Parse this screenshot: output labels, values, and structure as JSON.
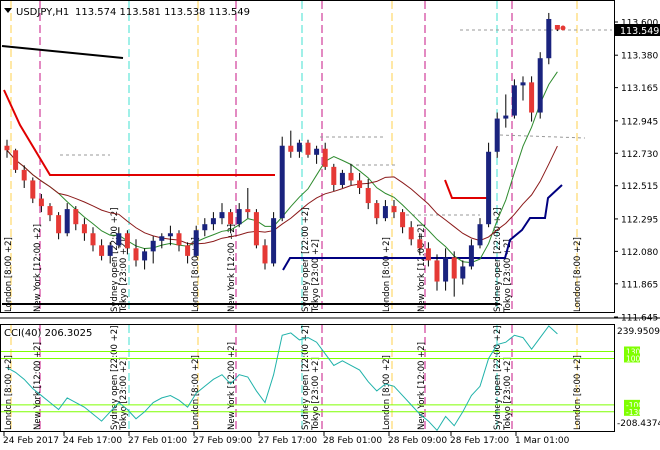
{
  "header": {
    "symbol_timeframe": "USDJPY,H1",
    "ohlc": "113.574 113.581 113.538 113.549"
  },
  "main_panel": {
    "price_labels": [
      "113.600",
      "113.380",
      "113.165",
      "112.945",
      "112.730",
      "112.515",
      "112.295",
      "112.080",
      "111.865",
      "111.645"
    ],
    "current_price": "113.549"
  },
  "indicator_panel": {
    "title": "CCI(40) 206.3025",
    "scale_labels": [
      "239.9509",
      "-208.4374"
    ],
    "level_labels": [
      "130",
      "100",
      "-100",
      "-130"
    ]
  },
  "session_labels": {
    "london": "London [8:00 +2]",
    "new_york": "New York [12:00 +2]",
    "sydney": "Sydney open [22:00 +2]",
    "tokyo": "Tokyo [23:00 +2]"
  },
  "time_labels": [
    "24 Feb 2017",
    "24 Feb 17:00",
    "27 Feb 01:00",
    "27 Feb 09:00",
    "27 Feb 17:00",
    "28 Feb 01:00",
    "28 Feb 09:00",
    "28 Feb 17:00",
    "1 Mar 01:00"
  ],
  "colors": {
    "bull_candle": "#1a237e",
    "bear_candle": "#e53935",
    "ma_green": "#2e8b2e",
    "ma_dark_red": "#8b1a1a",
    "line_red": "#e00000",
    "line_navy": "#000080",
    "cci_line": "#20b2aa",
    "level_green": "#7fff00",
    "session_london": "#ffd24d",
    "session_newyork": "#c71585",
    "session_sydney": "#40e0d0"
  },
  "chart_data": {
    "type": "candlestick",
    "ohlc": [
      [
        112.78,
        112.82,
        112.7,
        112.75
      ],
      [
        112.75,
        112.76,
        112.6,
        112.62
      ],
      [
        112.62,
        112.65,
        112.5,
        112.55
      ],
      [
        112.55,
        112.57,
        112.4,
        112.43
      ],
      [
        112.43,
        112.46,
        112.34,
        112.38
      ],
      [
        112.38,
        112.4,
        112.28,
        112.32
      ],
      [
        112.32,
        112.34,
        112.16,
        112.2
      ],
      [
        112.2,
        112.4,
        112.18,
        112.36
      ],
      [
        112.36,
        112.38,
        112.22,
        112.26
      ],
      [
        112.26,
        112.3,
        112.15,
        112.2
      ],
      [
        112.2,
        112.24,
        112.08,
        112.12
      ],
      [
        112.12,
        112.16,
        112.02,
        112.05
      ],
      [
        112.05,
        112.14,
        112.0,
        112.12
      ],
      [
        112.12,
        112.24,
        112.1,
        112.2
      ],
      [
        112.2,
        112.22,
        112.06,
        112.1
      ],
      [
        112.1,
        112.16,
        111.98,
        112.02
      ],
      [
        112.02,
        112.1,
        111.96,
        112.08
      ],
      [
        112.08,
        112.18,
        112.0,
        112.15
      ],
      [
        112.15,
        112.2,
        112.1,
        112.18
      ],
      [
        112.18,
        112.25,
        112.12,
        112.2
      ],
      [
        112.2,
        112.22,
        112.08,
        112.12
      ],
      [
        112.12,
        112.14,
        112.0,
        112.05
      ],
      [
        112.05,
        112.25,
        112.04,
        112.22
      ],
      [
        112.22,
        112.3,
        112.18,
        112.26
      ],
      [
        112.26,
        112.34,
        112.22,
        112.3
      ],
      [
        112.3,
        112.4,
        112.26,
        112.34
      ],
      [
        112.34,
        112.36,
        112.2,
        112.26
      ],
      [
        112.26,
        112.4,
        112.24,
        112.36
      ],
      [
        112.36,
        112.5,
        112.3,
        112.34
      ],
      [
        112.34,
        112.36,
        112.1,
        112.12
      ],
      [
        112.12,
        112.16,
        111.96,
        112.0
      ],
      [
        112.0,
        112.34,
        111.98,
        112.3
      ],
      [
        112.3,
        112.84,
        112.28,
        112.78
      ],
      [
        112.78,
        112.88,
        112.7,
        112.74
      ],
      [
        112.74,
        112.82,
        112.7,
        112.8
      ],
      [
        112.8,
        112.82,
        112.7,
        112.72
      ],
      [
        112.72,
        112.78,
        112.66,
        112.76
      ],
      [
        112.76,
        112.8,
        112.62,
        112.64
      ],
      [
        112.64,
        112.66,
        112.48,
        112.52
      ],
      [
        112.52,
        112.62,
        112.5,
        112.6
      ],
      [
        112.6,
        112.66,
        112.52,
        112.55
      ],
      [
        112.55,
        112.6,
        112.46,
        112.5
      ],
      [
        112.5,
        112.56,
        112.36,
        112.4
      ],
      [
        112.4,
        112.42,
        112.26,
        112.3
      ],
      [
        112.3,
        112.42,
        112.28,
        112.38
      ],
      [
        112.38,
        112.42,
        112.3,
        112.34
      ],
      [
        112.34,
        112.36,
        112.2,
        112.24
      ],
      [
        112.24,
        112.28,
        112.12,
        112.16
      ],
      [
        112.16,
        112.2,
        112.06,
        112.1
      ],
      [
        112.1,
        112.14,
        111.98,
        112.02
      ],
      [
        112.02,
        112.06,
        111.82,
        111.88
      ],
      [
        111.88,
        112.1,
        111.82,
        112.04
      ],
      [
        112.04,
        112.08,
        111.78,
        111.9
      ],
      [
        111.9,
        112.02,
        111.86,
        111.98
      ],
      [
        111.98,
        112.16,
        111.96,
        112.12
      ],
      [
        112.12,
        112.3,
        112.1,
        112.26
      ],
      [
        112.26,
        112.8,
        112.24,
        112.74
      ],
      [
        112.74,
        113.0,
        112.7,
        112.96
      ],
      [
        112.96,
        113.12,
        112.9,
        112.98
      ],
      [
        112.98,
        113.22,
        112.96,
        113.18
      ],
      [
        113.18,
        113.24,
        113.08,
        113.2
      ],
      [
        113.2,
        113.24,
        112.94,
        113.0
      ],
      [
        113.0,
        113.4,
        112.96,
        113.36
      ],
      [
        113.36,
        113.66,
        113.32,
        113.62
      ],
      [
        113.58,
        113.58,
        113.54,
        113.55
      ]
    ],
    "cci": [
      60,
      40,
      10,
      -30,
      -60,
      -90,
      -120,
      -70,
      -90,
      -110,
      -140,
      -170,
      -130,
      -90,
      -120,
      -160,
      -130,
      -90,
      -70,
      -60,
      -80,
      -110,
      -50,
      -20,
      10,
      30,
      -10,
      30,
      20,
      -40,
      -90,
      30,
      200,
      210,
      180,
      190,
      170,
      120,
      70,
      90,
      70,
      50,
      0,
      -40,
      -10,
      -20,
      -60,
      -100,
      -140,
      -170,
      -210,
      -150,
      -190,
      -130,
      -60,
      -20,
      100,
      160,
      170,
      200,
      190,
      140,
      190,
      240,
      206
    ],
    "ylim": [
      111.645,
      113.6
    ],
    "cci_ylim": [
      -208.4374,
      239.9509
    ]
  }
}
